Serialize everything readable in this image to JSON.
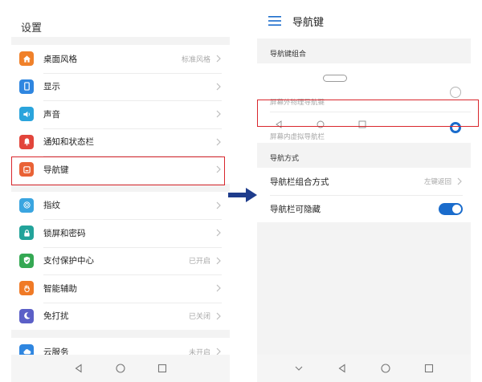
{
  "left": {
    "title": "设置",
    "groups": [
      [
        {
          "label": "桌面风格",
          "value": "标准风格",
          "icon": "home-icon",
          "color": "#f0812a"
        },
        {
          "label": "显示",
          "value": "",
          "icon": "phone-display-icon",
          "color": "#2f86e0"
        },
        {
          "label": "声音",
          "value": "",
          "icon": "speaker-icon",
          "color": "#2aa4dc"
        },
        {
          "label": "通知和状态栏",
          "value": "",
          "icon": "bell-icon",
          "color": "#e2453b"
        },
        {
          "label": "导航键",
          "value": "",
          "icon": "navigation-key-icon",
          "color": "#e96236"
        }
      ],
      [
        {
          "label": "指纹",
          "value": "",
          "icon": "fingerprint-icon",
          "color": "#3aa5e0"
        },
        {
          "label": "锁屏和密码",
          "value": "",
          "icon": "lock-icon",
          "color": "#22a39a"
        },
        {
          "label": "支付保护中心",
          "value": "已开启",
          "icon": "shield-check-icon",
          "color": "#34a853"
        },
        {
          "label": "智能辅助",
          "value": "",
          "icon": "hand-icon",
          "color": "#f07a26"
        },
        {
          "label": "免打扰",
          "value": "已关闭",
          "icon": "moon-icon",
          "color": "#5b5fc7"
        }
      ],
      [
        {
          "label": "云服务",
          "value": "未开启",
          "icon": "cloud-icon",
          "color": "#2f86e0"
        }
      ]
    ]
  },
  "right": {
    "title": "导航键",
    "section_combo": "导航键组合",
    "combo_physical": "屏幕外物理导航键",
    "combo_virtual": "屏幕内虚拟导航栏",
    "section_method": "导航方式",
    "method_label": "导航栏组合方式",
    "method_value": "左键返回",
    "hide_label": "导航栏可隐藏",
    "hide_enabled": true
  },
  "colors": {
    "accent": "#1a6ccc",
    "highlight": "#d9262c",
    "arrow": "#1e3c8c"
  }
}
